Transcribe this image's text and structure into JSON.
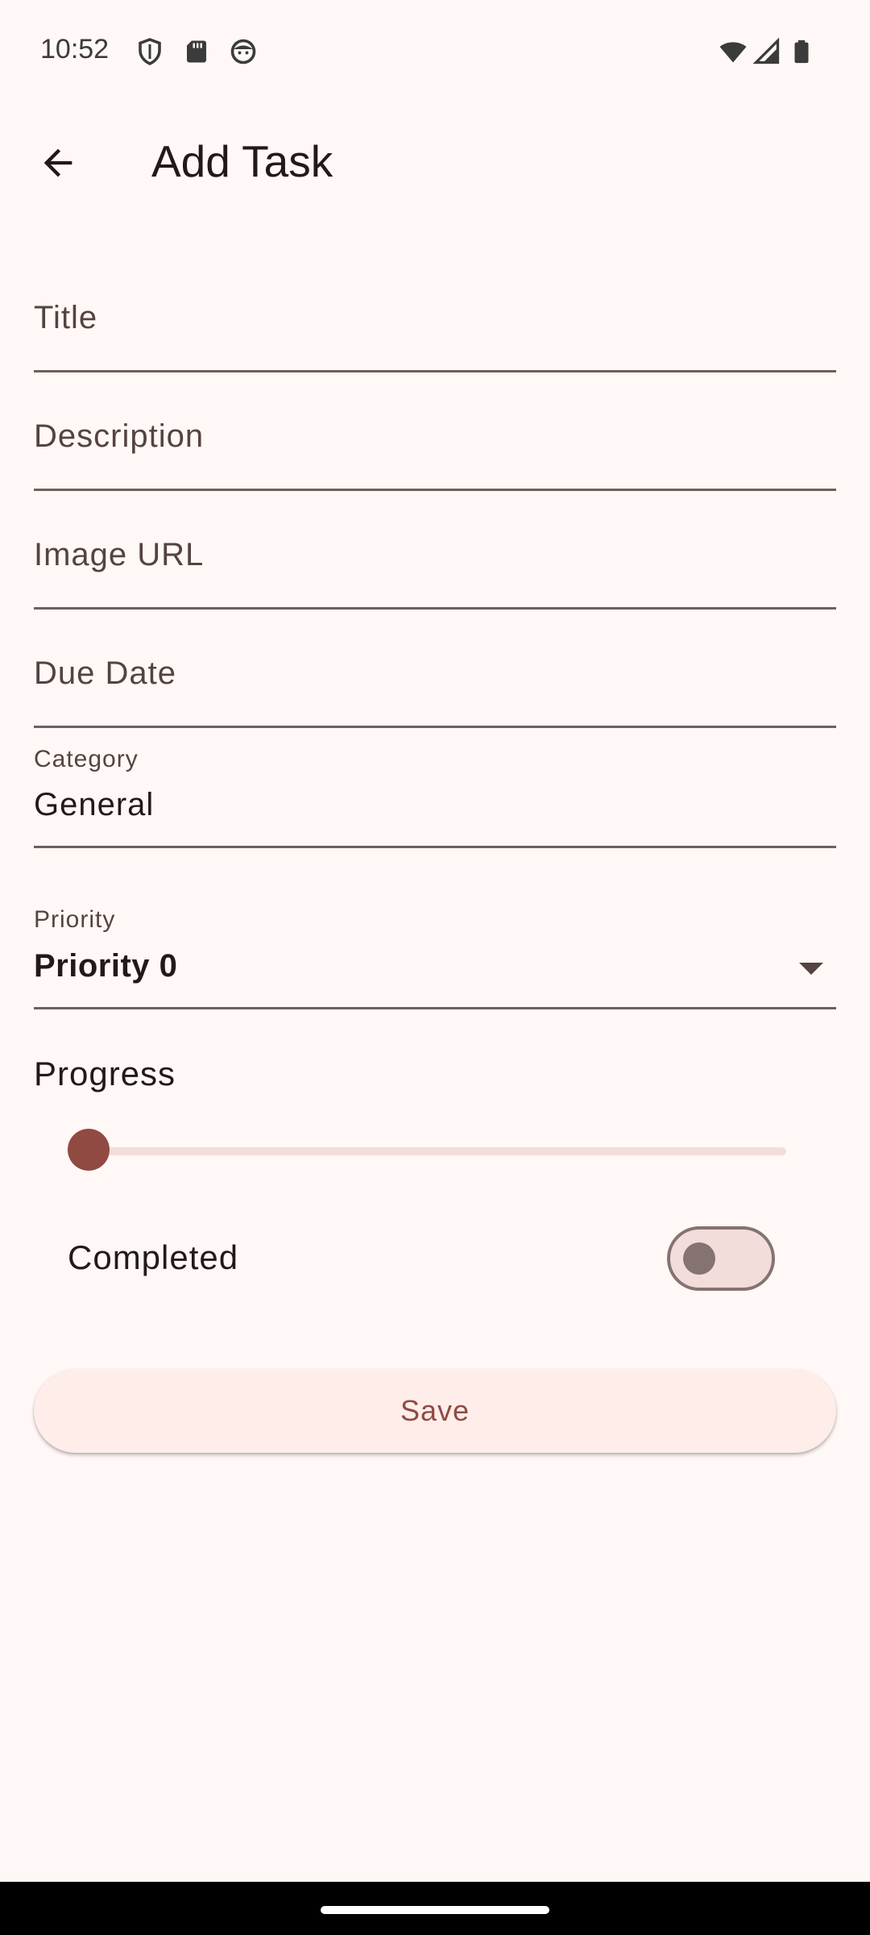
{
  "status_bar": {
    "time": "10:52",
    "icons": [
      "shield-icon",
      "sd-card-icon",
      "face-icon",
      "wifi-icon",
      "cell-signal-icon",
      "battery-icon"
    ]
  },
  "app_bar": {
    "title": "Add Task",
    "back_icon": "arrow-back-icon"
  },
  "form": {
    "title_placeholder": "Title",
    "description_placeholder": "Description",
    "image_url_placeholder": "Image URL",
    "due_date_placeholder": "Due Date",
    "category": {
      "label": "Category",
      "value": "General"
    },
    "priority": {
      "label": "Priority",
      "value": "Priority 0"
    },
    "progress": {
      "label": "Progress",
      "value": 0
    },
    "completed": {
      "label": "Completed",
      "checked": false
    },
    "save_label": "Save"
  },
  "colors": {
    "background": "#FFF8F6",
    "primary": "#904A42",
    "outline": "#857371",
    "button_bg": "#FFEDEA"
  }
}
